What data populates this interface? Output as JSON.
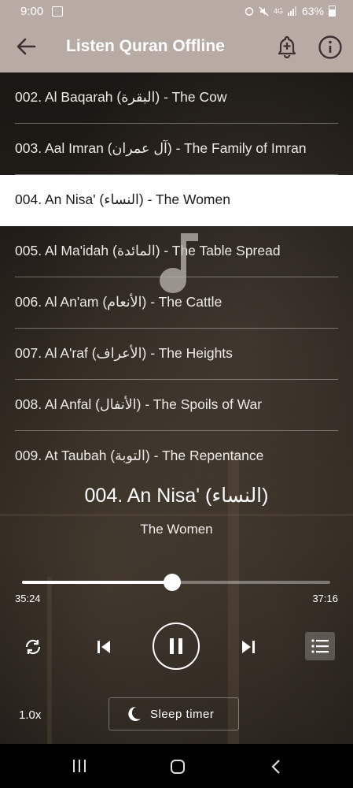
{
  "status_bar": {
    "time": "9:00",
    "network": "4G",
    "battery": "63%"
  },
  "app_bar": {
    "title": "Listen Quran Offline",
    "back_icon": "arrow-left-icon",
    "alarm_icon": "alarm-add-icon",
    "info_icon": "info-icon"
  },
  "surah_list": [
    {
      "label": "002. Al Baqarah (البقرة) - The Cow",
      "active": false
    },
    {
      "label": "003. Aal Imran (آل عمران) - The Family of Imran",
      "active": false
    },
    {
      "label": "004. An Nisa' (النساء) - The Women",
      "active": true
    },
    {
      "label": "005. Al Ma'idah (المائدة) - The Table Spread",
      "active": false
    },
    {
      "label": "006. Al An'am (الأنعام) - The Cattle",
      "active": false
    },
    {
      "label": "007. Al A'raf (الأعراف) - The Heights",
      "active": false
    },
    {
      "label": "008. Al Anfal (الأنفال) - The Spoils of War",
      "active": false
    },
    {
      "label": "009. At Taubah (التوبة) - The Repentance",
      "active": false
    }
  ],
  "player": {
    "title": "004. An Nisa' (النساء)",
    "subtitle": "The Women",
    "current_time": "35:24",
    "total_time": "37:16",
    "progress": 0.488,
    "state": "playing",
    "speed": "1.0x",
    "sleep_timer_label": "Sleep timer"
  },
  "colors": {
    "header": "#b8aba4",
    "active_row": "#ffffff",
    "nav_bar": "#000000"
  }
}
